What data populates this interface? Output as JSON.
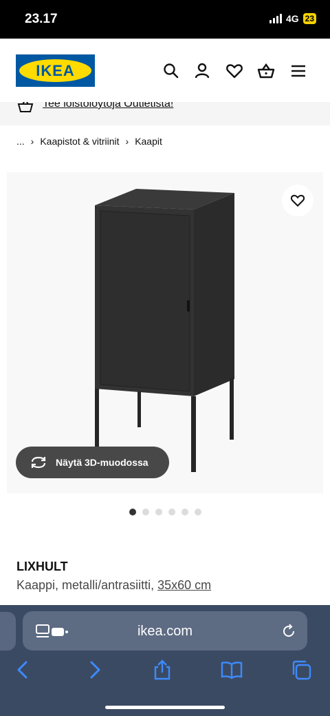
{
  "status_bar": {
    "time": "23.17",
    "network": "4G",
    "battery": "23"
  },
  "header": {
    "logo_text": "IKEA",
    "icons": [
      "search-icon",
      "user-icon",
      "heart-icon",
      "basket-icon",
      "menu-icon"
    ]
  },
  "promo": {
    "text": "Tee löistölöytöja Outletista!"
  },
  "breadcrumb": {
    "root": "...",
    "items": [
      "Kaapistot & vitriinit",
      "Kaapit"
    ]
  },
  "gallery": {
    "view_3d_label": "Näytä 3D-muodossa",
    "image_count": 6,
    "active_index": 0
  },
  "product": {
    "name": "LIXHULT",
    "description": "Kaappi, metalli/antrasiitti, ",
    "size": "35x60 cm"
  },
  "browser": {
    "url": "ikea.com",
    "toolbar": [
      "back-icon",
      "forward-icon",
      "share-icon",
      "bookmarks-icon",
      "tabs-icon"
    ]
  },
  "colors": {
    "ikea_blue": "#0058a3",
    "ikea_yellow": "#ffdb00",
    "browser_bar": "#3b4a63",
    "ios_blue": "#3d8bff"
  }
}
